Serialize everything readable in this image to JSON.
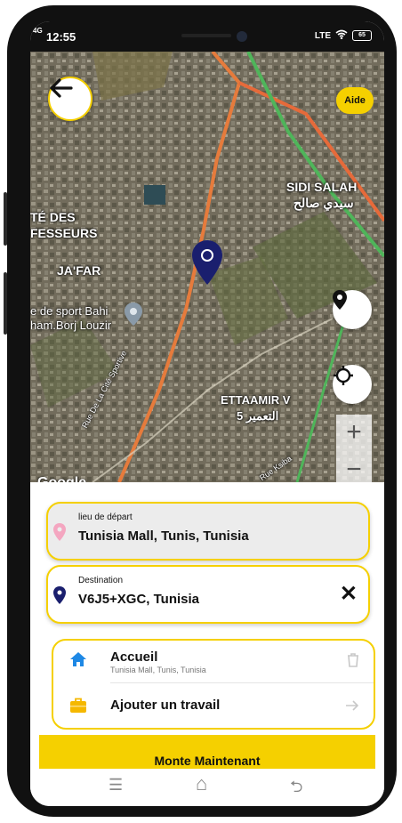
{
  "status_bar": {
    "signal": "4G",
    "time": "12:55",
    "network": "LTE",
    "battery": "65"
  },
  "map": {
    "labels": {
      "sidi_salah": "SIDI SALAH",
      "sidi_salah_ar": "سيدي صالح",
      "te_des": "TÉ DES",
      "fesseurs": "FESSEURS",
      "jafar": "JA'FAR",
      "sport": "e de sport Bahi",
      "borj": "ham.Borj Louzir",
      "ettaamir": "ETTAAMIR V",
      "ettaamir_ar": "التعمير 5",
      "road1": "Rue De La Cité Sportive",
      "road2": "Rue Ksiba"
    },
    "attribution": "Google",
    "aide_label": "Aide",
    "zoom_in": "+",
    "zoom_out": "−"
  },
  "route": {
    "start_label": "lieu de départ",
    "start_value": "Tunisia Mall, Tunis, Tunisia",
    "dest_label": "Destination",
    "dest_value": "V6J5+XGC, Tunisia",
    "clear": "✕"
  },
  "saved_places": [
    {
      "title": "Accueil",
      "subtitle": "Tunisia Mall, Tunis, Tunisia",
      "icon": "home-icon",
      "action_icon": "trash-icon"
    },
    {
      "title": "Ajouter un travail",
      "subtitle": "",
      "icon": "briefcase-icon",
      "action_icon": "arrow-right-icon"
    }
  ],
  "cta_label": "Monte Maintenant",
  "nav": {
    "menu": "☰",
    "home": "⌂",
    "back": "⮌"
  },
  "colors": {
    "accent": "#F5D000",
    "pin": "#1A1F6E",
    "start_pin": "#F4A6C0"
  }
}
